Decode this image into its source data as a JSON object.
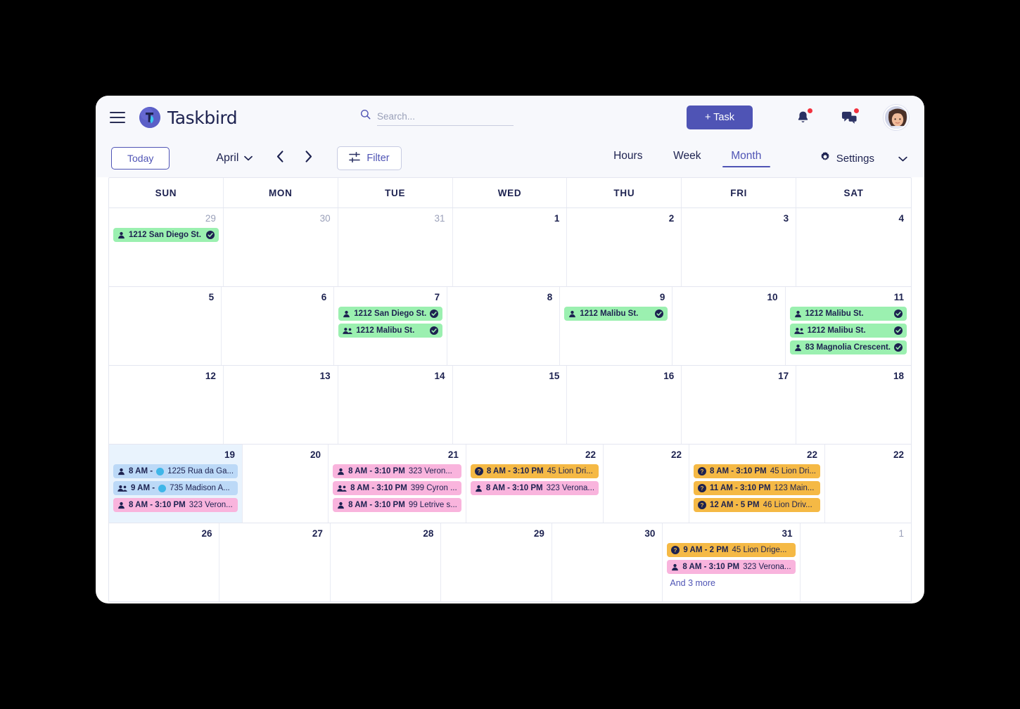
{
  "app": {
    "brand_name": "Taskbird",
    "logo_icon": "taskbird-logo-icon",
    "menu_icon": "hamburger-menu-icon"
  },
  "search": {
    "placeholder": "Search...",
    "value": "",
    "icon": "search-icon"
  },
  "header": {
    "add_task_label": "+ Task",
    "notifications_icon": "bell-icon",
    "messages_icon": "chat-bubble-icon",
    "avatar_icon": "user-avatar",
    "accent_color": "#4f54b5",
    "badge_color": "#f2323f"
  },
  "toolbar": {
    "today_label": "Today",
    "month_label": "April",
    "month_caret_icon": "chevron-down-icon",
    "prev_icon": "chevron-left-icon",
    "next_icon": "chevron-right-icon",
    "filter_label": "Filter",
    "filter_icon": "sliders-icon",
    "views": [
      {
        "label": "Hours",
        "active": false
      },
      {
        "label": "Week",
        "active": false
      },
      {
        "label": "Month",
        "active": true
      }
    ],
    "settings_label": "Settings",
    "settings_icon": "gear-icon",
    "settings_caret_icon": "chevron-down-icon"
  },
  "calendar": {
    "day_headers": [
      "SUN",
      "MON",
      "TUE",
      "WED",
      "THU",
      "FRI",
      "SAT"
    ],
    "weeks": [
      {
        "days": [
          {
            "num": "29",
            "muted": true,
            "today": false,
            "events": [
              {
                "color": "green",
                "icon": "person-icon",
                "time": "",
                "title": "1212 San Diego St.",
                "title_bold": true,
                "check": true
              }
            ]
          },
          {
            "num": "30",
            "muted": true,
            "today": false,
            "events": []
          },
          {
            "num": "31",
            "muted": true,
            "today": false,
            "events": []
          },
          {
            "num": "1",
            "muted": false,
            "today": false,
            "events": []
          },
          {
            "num": "2",
            "muted": false,
            "today": false,
            "events": []
          },
          {
            "num": "3",
            "muted": false,
            "today": false,
            "events": []
          },
          {
            "num": "4",
            "muted": false,
            "today": false,
            "events": []
          }
        ]
      },
      {
        "days": [
          {
            "num": "5",
            "muted": false,
            "today": false,
            "events": []
          },
          {
            "num": "6",
            "muted": false,
            "today": false,
            "events": []
          },
          {
            "num": "7",
            "muted": false,
            "today": false,
            "events": [
              {
                "color": "green",
                "icon": "person-icon",
                "time": "",
                "title": "1212 San Diego St.",
                "title_bold": true,
                "check": true
              },
              {
                "color": "green",
                "icon": "people-icon",
                "time": "",
                "title": "1212 Malibu St.",
                "title_bold": true,
                "check": true
              }
            ]
          },
          {
            "num": "8",
            "muted": false,
            "today": false,
            "events": []
          },
          {
            "num": "9",
            "muted": false,
            "today": false,
            "events": [
              {
                "color": "green",
                "icon": "person-icon",
                "time": "",
                "title": "1212 Malibu St.",
                "title_bold": true,
                "check": true
              }
            ]
          },
          {
            "num": "10",
            "muted": false,
            "today": false,
            "events": []
          },
          {
            "num": "11",
            "muted": false,
            "today": false,
            "events": [
              {
                "color": "green",
                "icon": "person-icon",
                "time": "",
                "title": "1212 Malibu St.",
                "title_bold": true,
                "check": true
              },
              {
                "color": "green",
                "icon": "people-icon",
                "time": "",
                "title": "1212 Malibu St.",
                "title_bold": true,
                "check": true
              },
              {
                "color": "green",
                "icon": "person-icon",
                "time": "",
                "title": "83 Magnolia Crescent.",
                "title_bold": true,
                "check": true
              }
            ]
          }
        ]
      },
      {
        "days": [
          {
            "num": "12",
            "muted": false,
            "today": false,
            "events": []
          },
          {
            "num": "13",
            "muted": false,
            "today": false,
            "events": []
          },
          {
            "num": "14",
            "muted": false,
            "today": false,
            "events": []
          },
          {
            "num": "15",
            "muted": false,
            "today": false,
            "events": []
          },
          {
            "num": "16",
            "muted": false,
            "today": false,
            "events": []
          },
          {
            "num": "17",
            "muted": false,
            "today": false,
            "events": []
          },
          {
            "num": "18",
            "muted": false,
            "today": false,
            "events": []
          }
        ]
      },
      {
        "days": [
          {
            "num": "19",
            "muted": false,
            "today": true,
            "events": [
              {
                "color": "blue",
                "icon": "person-icon",
                "time": "8 AM -",
                "dot": true,
                "title": "1225 Rua da Ga...",
                "title_bold": false,
                "check": false
              },
              {
                "color": "blue",
                "icon": "people-icon",
                "time": "9 AM -",
                "dot": true,
                "title": "735 Madison A...",
                "title_bold": false,
                "check": false
              },
              {
                "color": "pink",
                "icon": "person-icon",
                "time": "8 AM - 3:10 PM",
                "title": "323 Veron...",
                "title_bold": false,
                "check": false
              }
            ]
          },
          {
            "num": "20",
            "muted": false,
            "today": false,
            "events": []
          },
          {
            "num": "21",
            "muted": false,
            "today": false,
            "events": [
              {
                "color": "pink",
                "icon": "person-icon",
                "time": "8 AM - 3:10 PM",
                "title": "323 Veron...",
                "title_bold": false,
                "check": false
              },
              {
                "color": "pink",
                "icon": "people-icon",
                "time": "8 AM - 3:10 PM",
                "title": "399 Cyron ...",
                "title_bold": false,
                "check": false
              },
              {
                "color": "pink",
                "icon": "person-icon",
                "time": "8 AM - 3:10 PM",
                "title": "99 Letrive s...",
                "title_bold": false,
                "check": false
              }
            ]
          },
          {
            "num": "22",
            "muted": false,
            "today": false,
            "events": [
              {
                "color": "orange",
                "icon": "question-icon",
                "time": "8 AM - 3:10 PM",
                "title": "45 Lion Dri...",
                "title_bold": false,
                "check": false
              },
              {
                "color": "pink",
                "icon": "person-icon",
                "time": "8 AM - 3:10 PM",
                "title": "323 Verona...",
                "title_bold": false,
                "check": false
              }
            ]
          },
          {
            "num": "22",
            "muted": false,
            "today": false,
            "events": []
          },
          {
            "num": "22",
            "muted": false,
            "today": false,
            "events": [
              {
                "color": "orange",
                "icon": "question-icon",
                "time": "8 AM - 3:10 PM",
                "title": "45 Lion Dri...",
                "title_bold": false,
                "check": false
              },
              {
                "color": "orange",
                "icon": "question-icon",
                "time": "11 AM - 3:10 PM",
                "title": "123 Main...",
                "title_bold": false,
                "check": false
              },
              {
                "color": "orange",
                "icon": "question-icon",
                "time": "12 AM - 5 PM",
                "title": "46 Lion Driv...",
                "title_bold": false,
                "check": false
              }
            ]
          },
          {
            "num": "22",
            "muted": false,
            "today": false,
            "events": []
          }
        ]
      },
      {
        "days": [
          {
            "num": "26",
            "muted": false,
            "today": false,
            "events": []
          },
          {
            "num": "27",
            "muted": false,
            "today": false,
            "events": []
          },
          {
            "num": "28",
            "muted": false,
            "today": false,
            "events": []
          },
          {
            "num": "29",
            "muted": false,
            "today": false,
            "events": []
          },
          {
            "num": "30",
            "muted": false,
            "today": false,
            "events": []
          },
          {
            "num": "31",
            "muted": false,
            "today": false,
            "events": [
              {
                "color": "orange",
                "icon": "question-icon",
                "time": "9 AM - 2 PM",
                "title": "45 Lion Drige...",
                "title_bold": false,
                "check": false
              },
              {
                "color": "pink",
                "icon": "person-icon",
                "time": "8 AM - 3:10 PM",
                "title": "323 Verona...",
                "title_bold": false,
                "check": false
              }
            ],
            "more": "And 3 more"
          },
          {
            "num": "1",
            "muted": true,
            "today": false,
            "events": []
          }
        ]
      }
    ]
  },
  "colors": {
    "green": "#9bf0b0",
    "blue": "#bcd9f7",
    "pink": "#f9b4dd",
    "orange": "#f5b945",
    "today_bg": "#e9f3fd",
    "text": "#1d2250"
  }
}
